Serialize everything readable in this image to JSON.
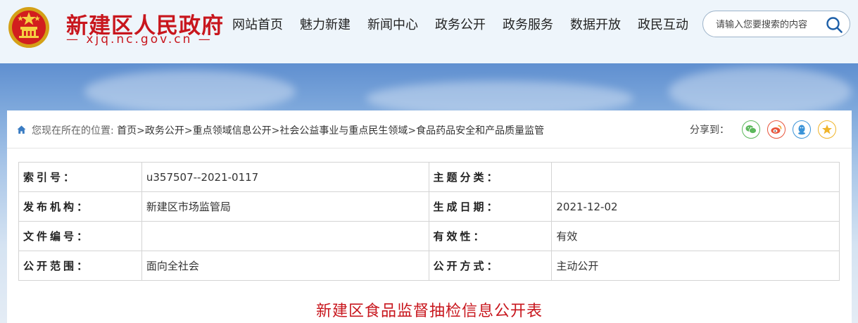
{
  "site": {
    "name": "新建区人民政府",
    "url": "— xjq.nc.gov.cn —",
    "brand_color": "#c8161d"
  },
  "nav": {
    "items": [
      "网站首页",
      "魅力新建",
      "新闻中心",
      "政务公开",
      "政务服务",
      "数据开放",
      "政民互动"
    ]
  },
  "search": {
    "placeholder": "请输入您要搜索的内容",
    "icon": "search-icon"
  },
  "breadcrumb": {
    "prefix": "您现在所在的位置:",
    "items": [
      "首页",
      "政务公开",
      "重点领域信息公开",
      "社会公益事业与重点民生领域",
      "食品药品安全和产品质量监管"
    ],
    "separator": ">"
  },
  "share": {
    "label": "分享到：",
    "targets": [
      "wechat-icon",
      "weibo-icon",
      "qq-icon",
      "qzone-icon"
    ]
  },
  "meta": {
    "rows": [
      {
        "k1": "索引号：",
        "v1": "u357507--2021-0117",
        "k2": "主题分类：",
        "v2": ""
      },
      {
        "k1": "发布机构：",
        "v1": "新建区市场监管局",
        "k2": "生成日期：",
        "v2": "2021-12-02"
      },
      {
        "k1": "文件编号：",
        "v1": "",
        "k2": "有效性：",
        "v2": "有效"
      },
      {
        "k1": "公开范围：",
        "v1": "面向全社会",
        "k2": "公开方式：",
        "v2": "主动公开"
      }
    ]
  },
  "document": {
    "title": "新建区食品监督抽检信息公开表"
  }
}
